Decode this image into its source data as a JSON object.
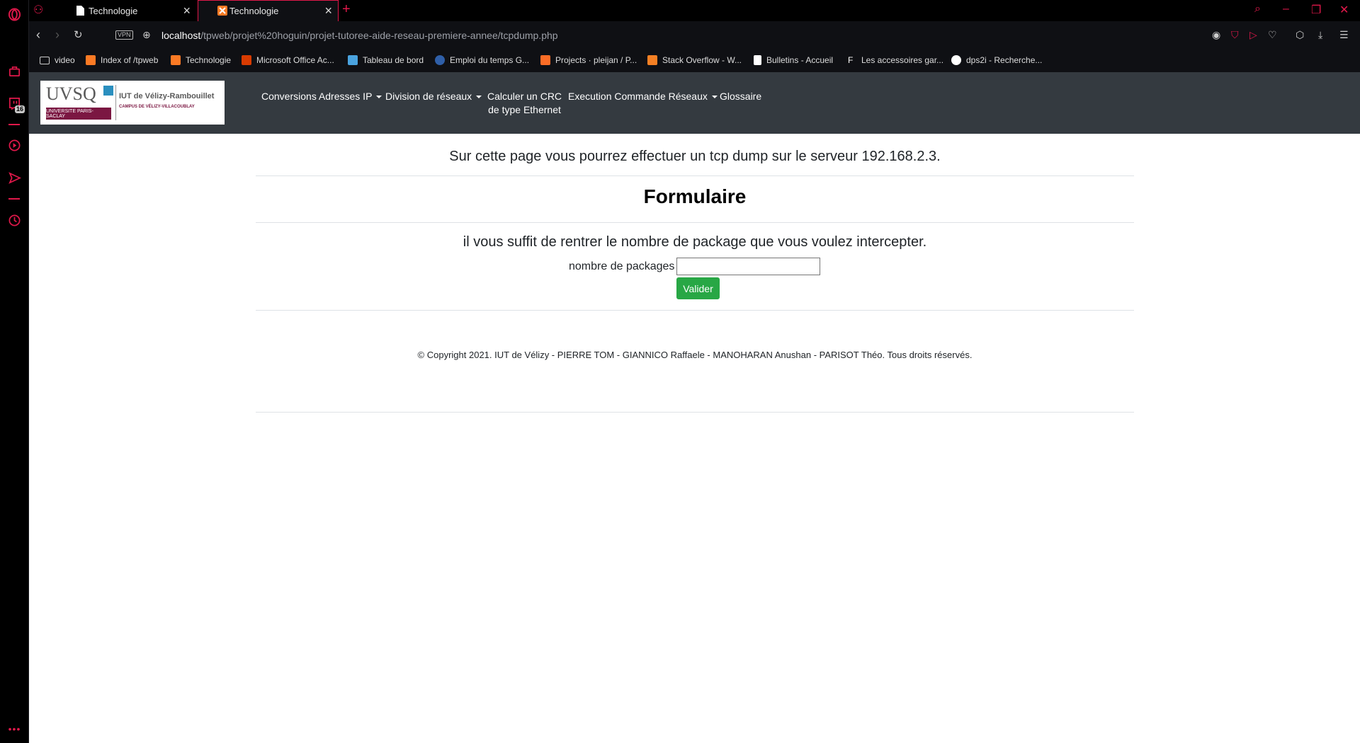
{
  "browser": {
    "tabs": [
      {
        "label": "Technologie",
        "active": false
      },
      {
        "label": "Technologie",
        "active": true
      }
    ],
    "vpn_label": "VPN",
    "url_host": "localhost",
    "url_path": "/tpweb/projet%20hoguin/projet-tutoree-aide-reseau-premiere-annee/tcpdump.php",
    "bookmarks": [
      "video",
      "Index of /tpweb",
      "Technologie",
      "Microsoft Office Ac...",
      "Tableau de bord",
      "Emploi du temps G...",
      "Projects · pleijan / P...",
      "Stack Overflow - W...",
      "Bulletins - Accueil",
      "Les accessoires gar...",
      "dps2i - Recherche..."
    ],
    "sidebar_badge": "16",
    "accent_color": "#e0184a"
  },
  "site": {
    "logo": {
      "brand": "UVSQ",
      "university": "UNIVERSITE PARIS-SACLAY",
      "institute": "IUT de Vélizy-Rambouillet",
      "campus": "CAMPUS DE VÉLIZY-VILLACOUBLAY"
    },
    "menu": {
      "conversions": "Conversions Adresses IP",
      "division": "Division de réseaux",
      "crc_line1": "Calculer un CRC",
      "crc_line2": "de type Ethernet",
      "execution": "Execution Commande Réseaux",
      "glossaire": "Glossaire"
    },
    "intro": "Sur cette page vous pourrez effectuer un tcp dump sur le serveur 192.168.2.3.",
    "title": "Formulaire",
    "subtitle": "il vous suffit de rentrer le nombre de package que vous voulez intercepter.",
    "form": {
      "label": "nombre de packages",
      "value": "",
      "submit": "Valider"
    },
    "footer": "© Copyright 2021. IUT de Vélizy - PIERRE TOM - GIANNICO Raffaele - MANOHARAN Anushan - PARISOT Théo. Tous droits réservés."
  }
}
